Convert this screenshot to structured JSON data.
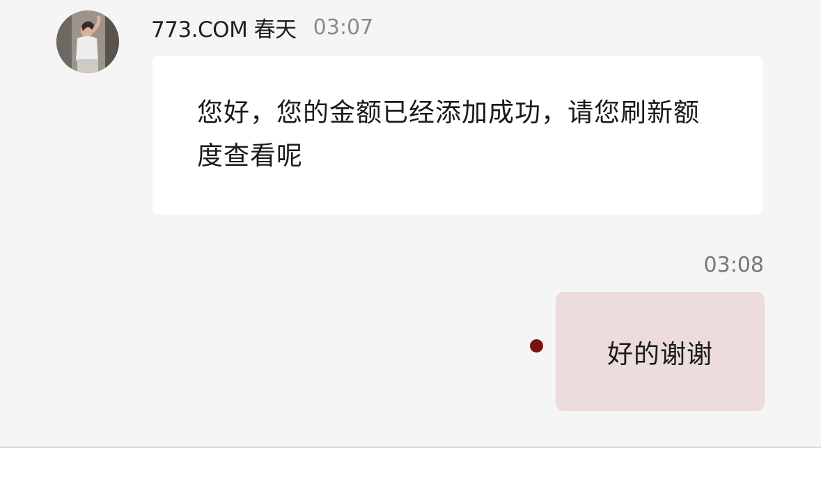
{
  "incoming": {
    "sender_name": "773.COM 春天",
    "time": "03:07",
    "avatar_icon": "user-avatar-photo",
    "text": "您好，您的金额已经添加成功，请您刷新额度查看呢"
  },
  "outgoing": {
    "time": "03:08",
    "text": "好的谢谢",
    "status_icon": "unread-dot-icon",
    "bubble_color": "#ecdcdc",
    "status_color": "#7a1212"
  }
}
